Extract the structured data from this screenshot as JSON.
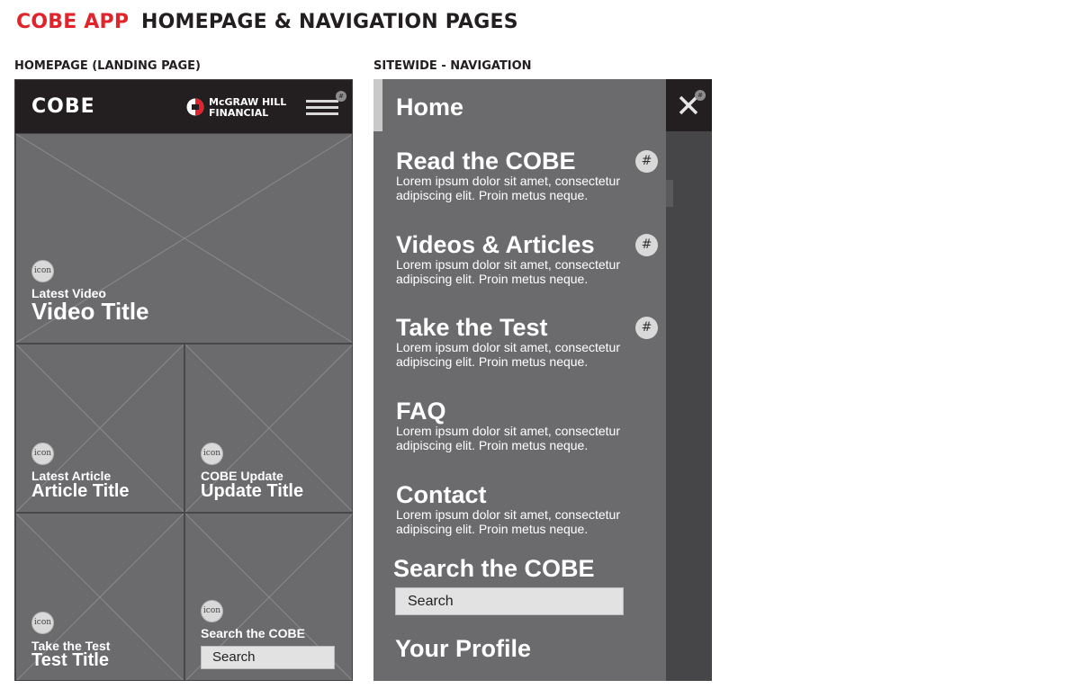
{
  "page": {
    "title_accent": "COBE APP",
    "title_main": "HOMEPAGE & NAVIGATION PAGES",
    "homepage_label": "HOMEPAGE (LANDING PAGE)",
    "navigation_label": "SITEWIDE - NAVIGATION"
  },
  "home": {
    "logo": "COBE",
    "brand_line1": "McGRAW HILL",
    "brand_line2": "FINANCIAL",
    "menu_badge": "#",
    "icon_text": "icon",
    "video": {
      "kicker": "Latest Video",
      "title": "Video Title"
    },
    "article": {
      "kicker": "Latest Article",
      "title": "Article Title"
    },
    "update": {
      "kicker": "COBE Update",
      "title": "Update Title"
    },
    "test": {
      "kicker": "Take the Test",
      "title": "Test Title"
    },
    "search": {
      "kicker": "Search the COBE",
      "placeholder": "Search"
    },
    "colors": {
      "header_bg": "#231f20",
      "tile_bg": "#6b6b6e",
      "brand_red": "#e1242c"
    }
  },
  "nav": {
    "close_badge": "#",
    "home": "Home",
    "items": [
      {
        "title": "Read the COBE",
        "desc": "Lorem ipsum dolor sit amet, consectetur adipiscing elit. Proin metus neque.",
        "badge": "#"
      },
      {
        "title": "Videos & Articles",
        "desc": "Lorem ipsum dolor sit amet, consectetur adipiscing elit. Proin metus neque.",
        "badge": "#"
      },
      {
        "title": "Take the Test",
        "desc": "Lorem ipsum dolor sit amet, consectetur adipiscing elit. Proin metus neque.",
        "badge": "#"
      },
      {
        "title": "FAQ",
        "desc": "Lorem ipsum dolor sit amet, consectetur adipiscing elit. Proin metus neque."
      },
      {
        "title": "Contact",
        "desc": "Lorem ipsum dolor sit amet, consectetur adipiscing elit. Proin metus neque."
      }
    ],
    "search_title": "Search the COBE",
    "search_placeholder": "Search",
    "profile": "Your Profile",
    "colors": {
      "panel_bg": "#6b6b6e",
      "overlay_bg": "#464648",
      "close_bg": "#231f20"
    }
  }
}
